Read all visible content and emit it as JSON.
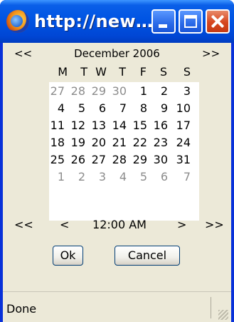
{
  "window": {
    "title": "http://new…"
  },
  "calendar": {
    "nav_prev": "<<",
    "nav_next": ">>",
    "month_label": "December 2006",
    "weekdays": [
      "M",
      "T",
      "W",
      "T",
      "F",
      "S",
      "S"
    ],
    "weeks": [
      [
        "27",
        "28",
        "29",
        "30",
        "1",
        "2",
        "3"
      ],
      [
        "4",
        "5",
        "6",
        "7",
        "8",
        "9",
        "10"
      ],
      [
        "11",
        "12",
        "13",
        "14",
        "15",
        "16",
        "17"
      ],
      [
        "18",
        "19",
        "20",
        "21",
        "22",
        "23",
        "24"
      ],
      [
        "25",
        "26",
        "27",
        "28",
        "29",
        "30",
        "31"
      ],
      [
        "1",
        "2",
        "3",
        "4",
        "5",
        "6",
        "7"
      ]
    ],
    "other_month_days": [
      [
        true,
        true,
        true,
        true,
        false,
        false,
        false
      ],
      [
        false,
        false,
        false,
        false,
        false,
        false,
        false
      ],
      [
        false,
        false,
        false,
        false,
        false,
        false,
        false
      ],
      [
        false,
        false,
        false,
        false,
        false,
        false,
        false
      ],
      [
        false,
        false,
        false,
        false,
        false,
        false,
        false
      ],
      [
        true,
        true,
        true,
        true,
        true,
        true,
        true
      ]
    ]
  },
  "time": {
    "prev_fast": "<<",
    "prev": "<",
    "value": "12:00 AM",
    "next": ">",
    "next_fast": ">>"
  },
  "buttons": {
    "ok": "Ok",
    "cancel": "Cancel"
  },
  "status": {
    "text": "Done"
  }
}
